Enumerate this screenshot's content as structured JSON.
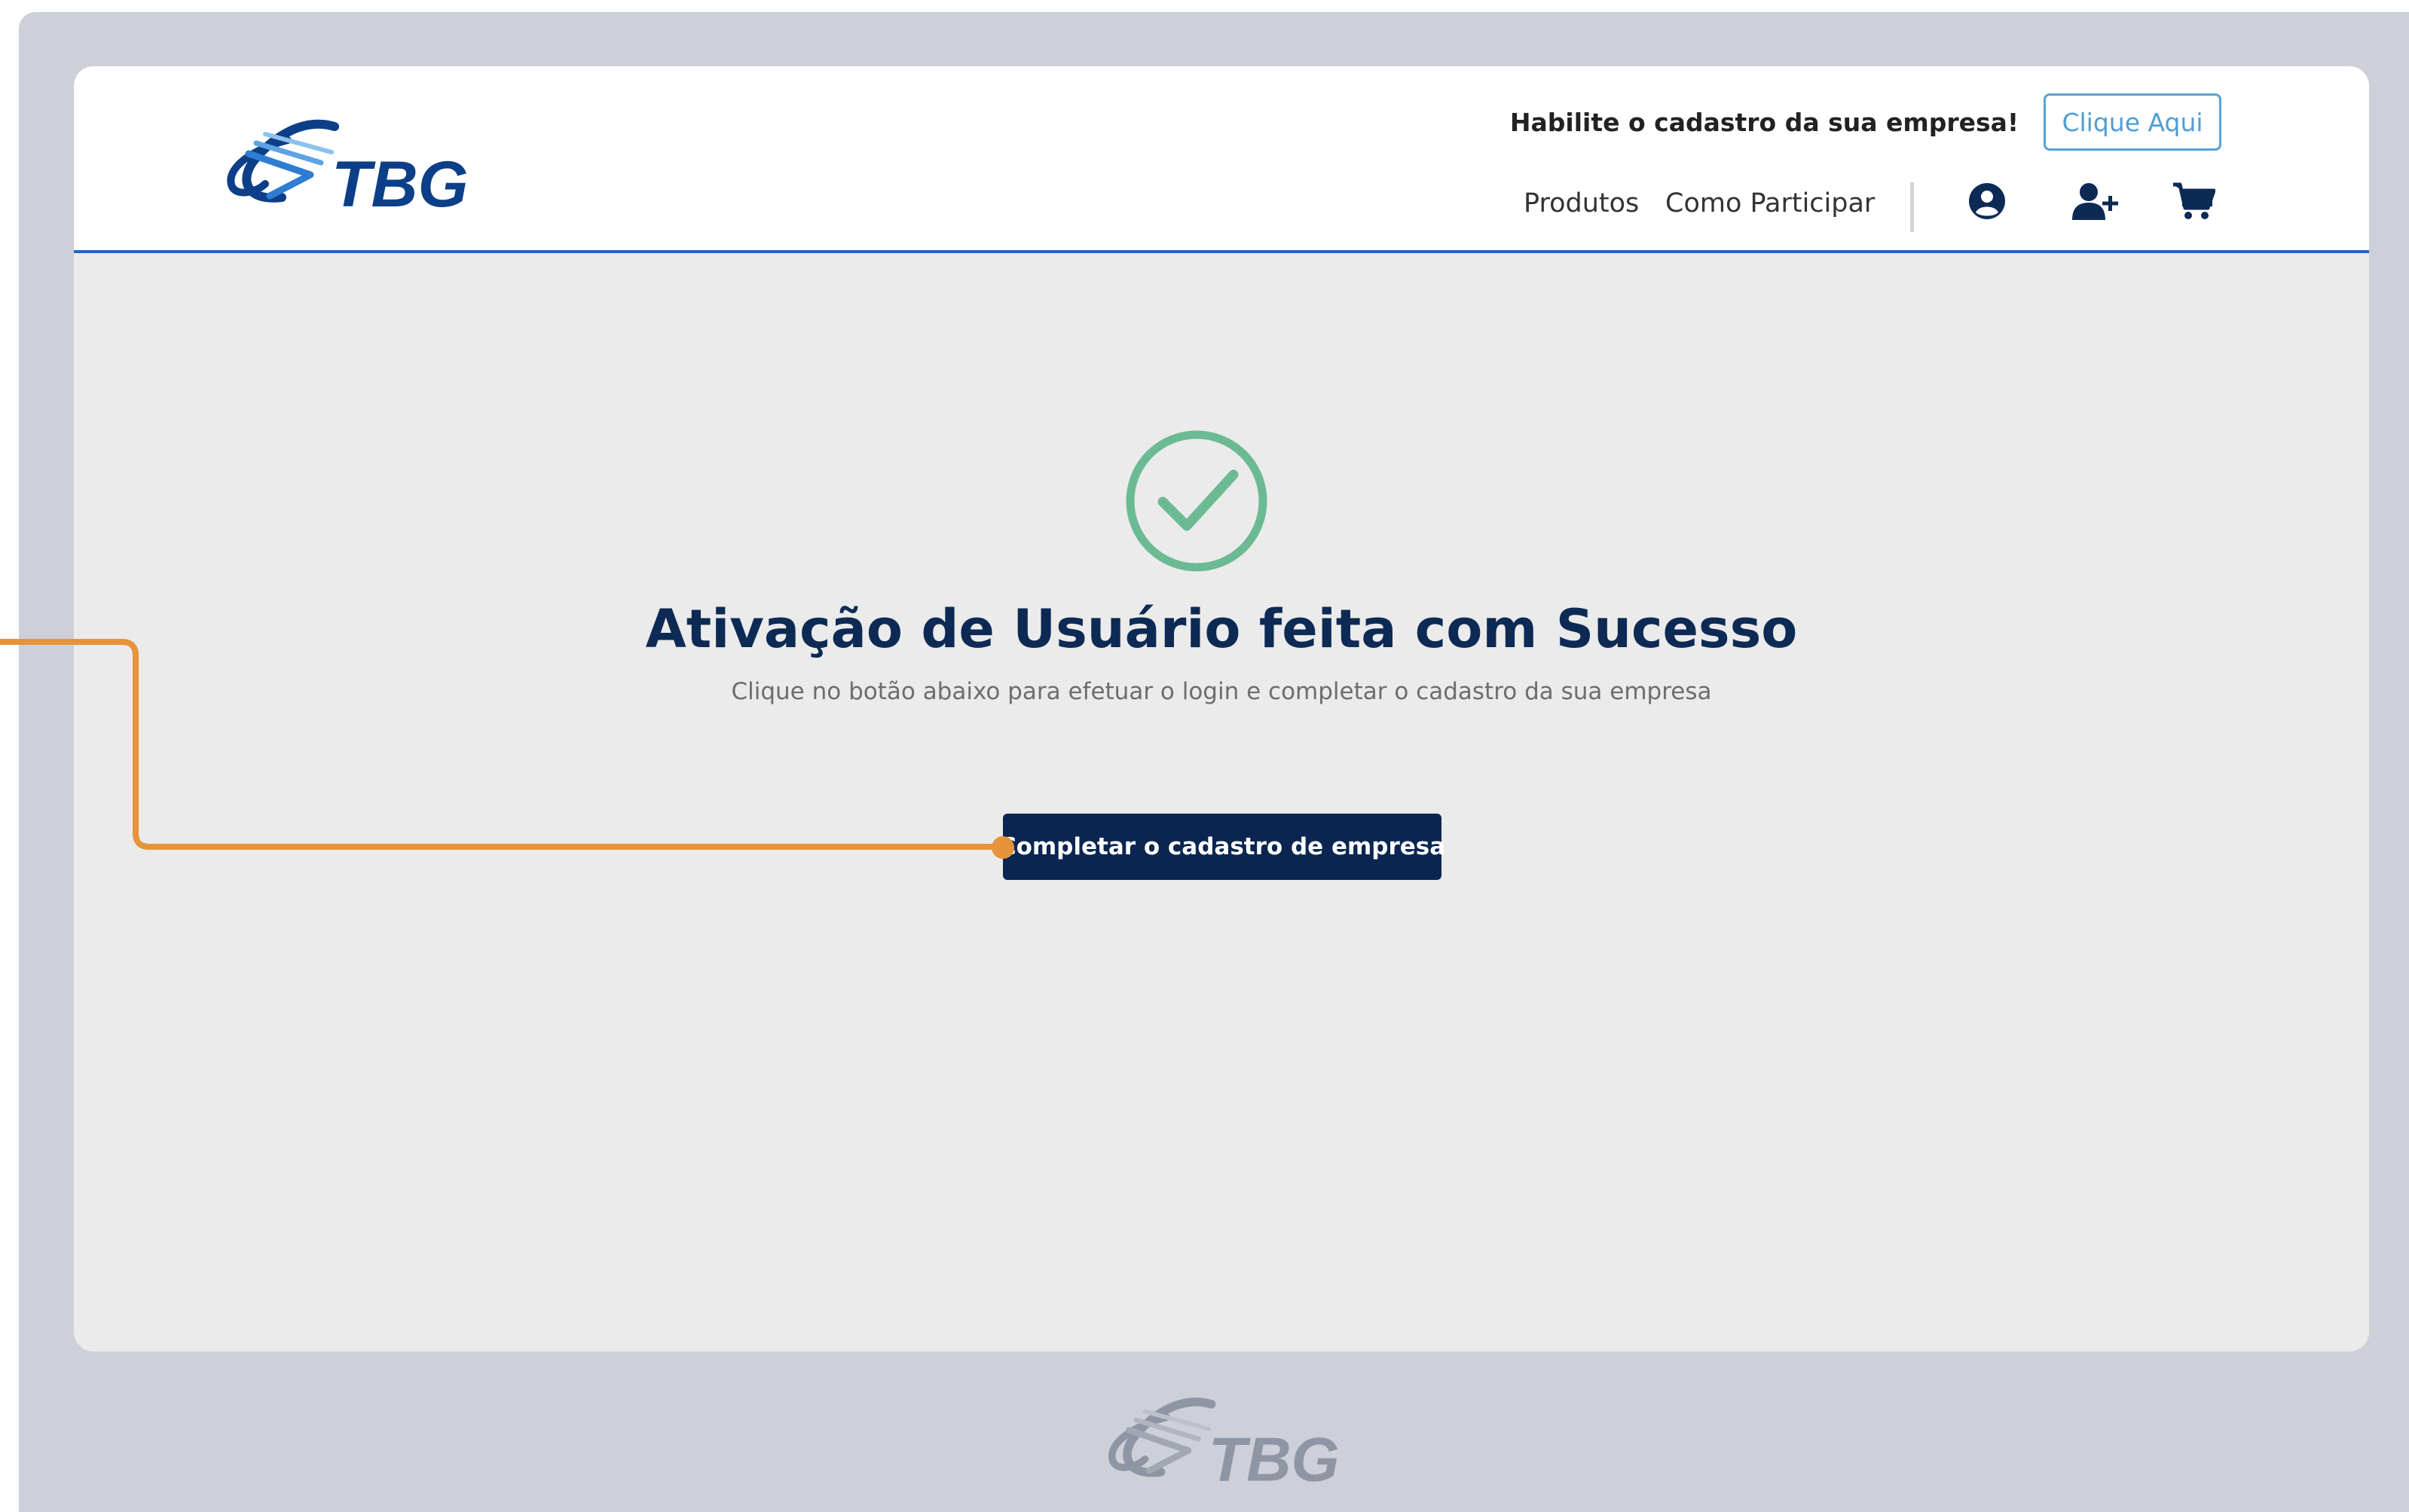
{
  "header": {
    "logo_text": "TBG",
    "promo_text": "Habilite o cadastro da sua empresa!",
    "cta_label": "Clique Aqui",
    "nav": [
      {
        "label": "Produtos"
      },
      {
        "label": "Como Participar"
      }
    ],
    "icons": [
      "user-circle-icon",
      "user-add-icon",
      "shopping-cart-icon"
    ]
  },
  "main": {
    "status_icon": "check-circle-icon",
    "title": "Ativação de Usuário feita com Sucesso",
    "subtitle": "Clique no botão abaixo para efetuar o login e completar o cadastro da sua empresa",
    "button_label": "Completar o cadastro de empresa"
  },
  "footer": {
    "logo_text": "TBG"
  },
  "colors": {
    "brand_navy": "#0a2650",
    "brand_blue": "#1f67bd",
    "success_green": "#6cba93",
    "annotation_orange": "#e6943b",
    "link_blue": "#4f9ed4"
  }
}
